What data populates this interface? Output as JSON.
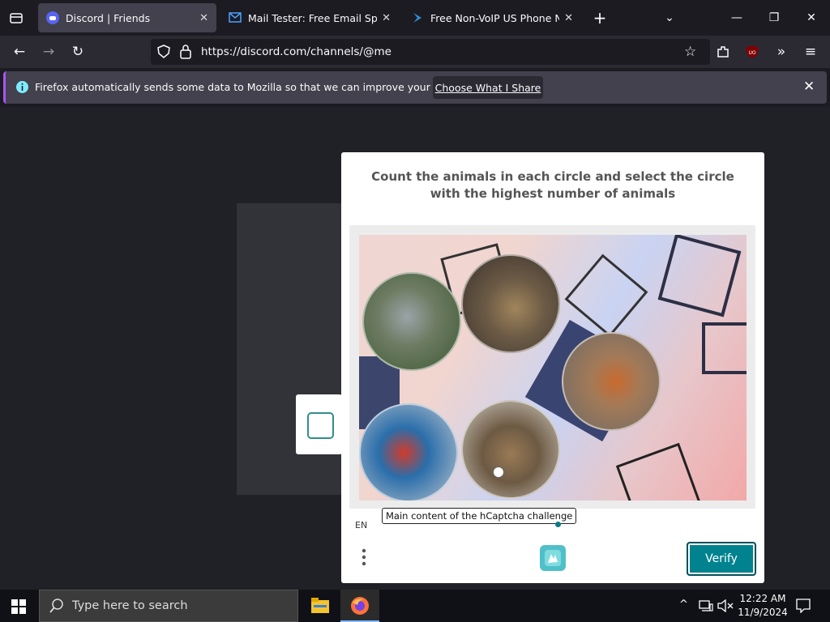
{
  "tabs": [
    {
      "label": "Discord | Friends",
      "icon": "discord-icon",
      "active": true
    },
    {
      "label": "Mail Tester: Free Email Spam Ch",
      "icon": "mail-icon",
      "active": false
    },
    {
      "label": "Free Non-VoIP US Phone Numb",
      "icon": "phone-icon",
      "active": false
    }
  ],
  "address_bar": {
    "url": "https://discord.com/channels/@me"
  },
  "notification": {
    "text": "Firefox automatically sends some data to Mozilla so that we can improve your experience.",
    "button_label": "Choose What I Share"
  },
  "captcha": {
    "prompt": "Count the animals in each circle and select the circle with the highest number of animals",
    "tooltip": "Main content of the hCaptcha challenge",
    "language": "EN",
    "verify_label": "Verify",
    "circles": [
      "parrot",
      "owl",
      "hen",
      "macaw",
      "owls"
    ]
  },
  "taskbar": {
    "search_placeholder": "Type here to search",
    "time": "12:22 AM",
    "date": "11/9/2024"
  },
  "colors": {
    "accent": "#00838f",
    "notify_border": "#a855f7"
  }
}
